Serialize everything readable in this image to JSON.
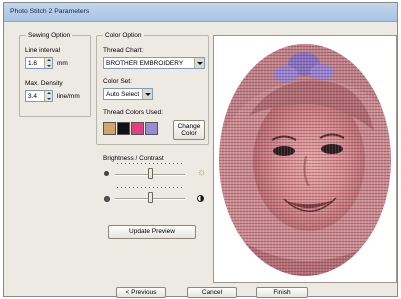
{
  "window": {
    "title": "Photo Stitch 2 Parameters"
  },
  "sewing_option": {
    "legend": "Sewing Option",
    "line_interval": {
      "label": "Line interval",
      "value": "1.6",
      "unit": "mm"
    },
    "max_density": {
      "label": "Max. Density",
      "value": "3.4",
      "unit": "line/mm"
    }
  },
  "color_option": {
    "legend": "Color Option",
    "thread_chart": {
      "label": "Thread Chart:",
      "value": "BROTHER EMBROIDERY"
    },
    "color_set": {
      "label": "Color Set:",
      "value": "Auto Select"
    },
    "thread_colors_used": {
      "label": "Thread Colors Used:"
    },
    "swatches": [
      "#d4a56a",
      "#111111",
      "#e2407e",
      "#9a8cd2"
    ],
    "change_color_button": {
      "line1": "Change",
      "line2": "Color"
    }
  },
  "brightness_contrast": {
    "legend": "Brightness / Contrast",
    "brightness": 0.5,
    "contrast": 0.5
  },
  "update_preview_button": "Update Preview",
  "footer": {
    "previous": "< Previous",
    "cancel": "Cancel",
    "finish": "Finish"
  }
}
